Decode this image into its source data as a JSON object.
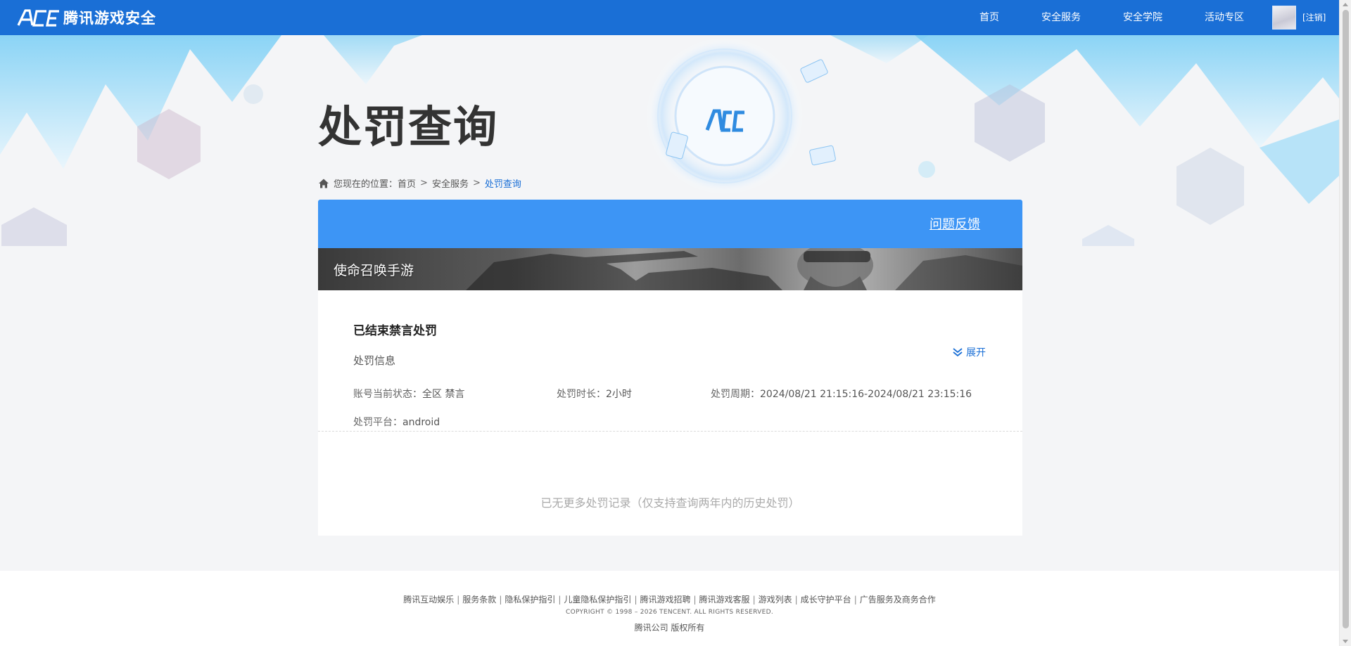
{
  "header": {
    "logo_text": "腾讯游戏安全",
    "nav": [
      "首页",
      "安全服务",
      "安全学院",
      "活动专区"
    ],
    "logout": "[注销]"
  },
  "page": {
    "title": "处罚查询",
    "breadcrumb": {
      "prefix": "您现在的位置：",
      "items": [
        "首页",
        "安全服务",
        "处罚查询"
      ],
      "separator": ">"
    }
  },
  "card": {
    "feedback_label": "问题反馈",
    "game_name": "使命召唤手游",
    "record": {
      "title": "已结束禁言处罚",
      "subtitle": "处罚信息",
      "fields": [
        {
          "label": "账号当前状态：",
          "value": "全区 禁言"
        },
        {
          "label": "处罚时长：",
          "value": "2小时"
        },
        {
          "label": "处罚周期：",
          "value": "2024/08/21 21:15:16-2024/08/21 23:15:16"
        },
        {
          "label": "处罚平台：",
          "value": "android"
        }
      ],
      "expand_label": "展开"
    },
    "no_more": "已无更多处罚记录（仅支持查询两年内的历史处罚）"
  },
  "footer": {
    "links": [
      "腾讯互动娱乐",
      "服务条款",
      "隐私保护指引",
      "儿童隐私保护指引",
      "腾讯游戏招聘",
      "腾讯游戏客服",
      "游戏列表",
      "成长守护平台",
      "广告服务及商务合作"
    ],
    "copyright": "COPYRIGHT © 1998 – 2026 TENCENT. ALL RIGHTS RESERVED.",
    "company": "腾讯公司 版权所有"
  },
  "colors": {
    "topbar": "#1a6fd6",
    "card_header": "#3d95f5",
    "accent_link": "#1a6fd6"
  }
}
